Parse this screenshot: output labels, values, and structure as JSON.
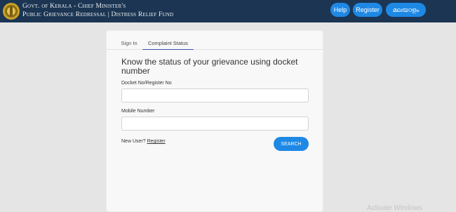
{
  "header": {
    "title_line1": "Govt. of Kerala -  Chief Minister's",
    "title_line2": "Public Grievance Redressal |  Distress Relief Fund",
    "help_label": "Help",
    "register_label": "Register",
    "language_label": "മലയാളം",
    "colors": {
      "bar": "#1b3553",
      "button": "#1e88e5"
    }
  },
  "tabs": [
    {
      "label": "Sign In"
    },
    {
      "label": "Complaint Status",
      "active": true
    }
  ],
  "form": {
    "heading": "Know the status of your grievance using docket number",
    "docket_label": "Docket No/Register No",
    "docket_value": "",
    "mobile_label": "Mobile Number",
    "mobile_value": "",
    "new_user_text": "New User?",
    "register_link": "Register",
    "search_label": "SEARCH"
  },
  "watermark": "Activate Windows"
}
